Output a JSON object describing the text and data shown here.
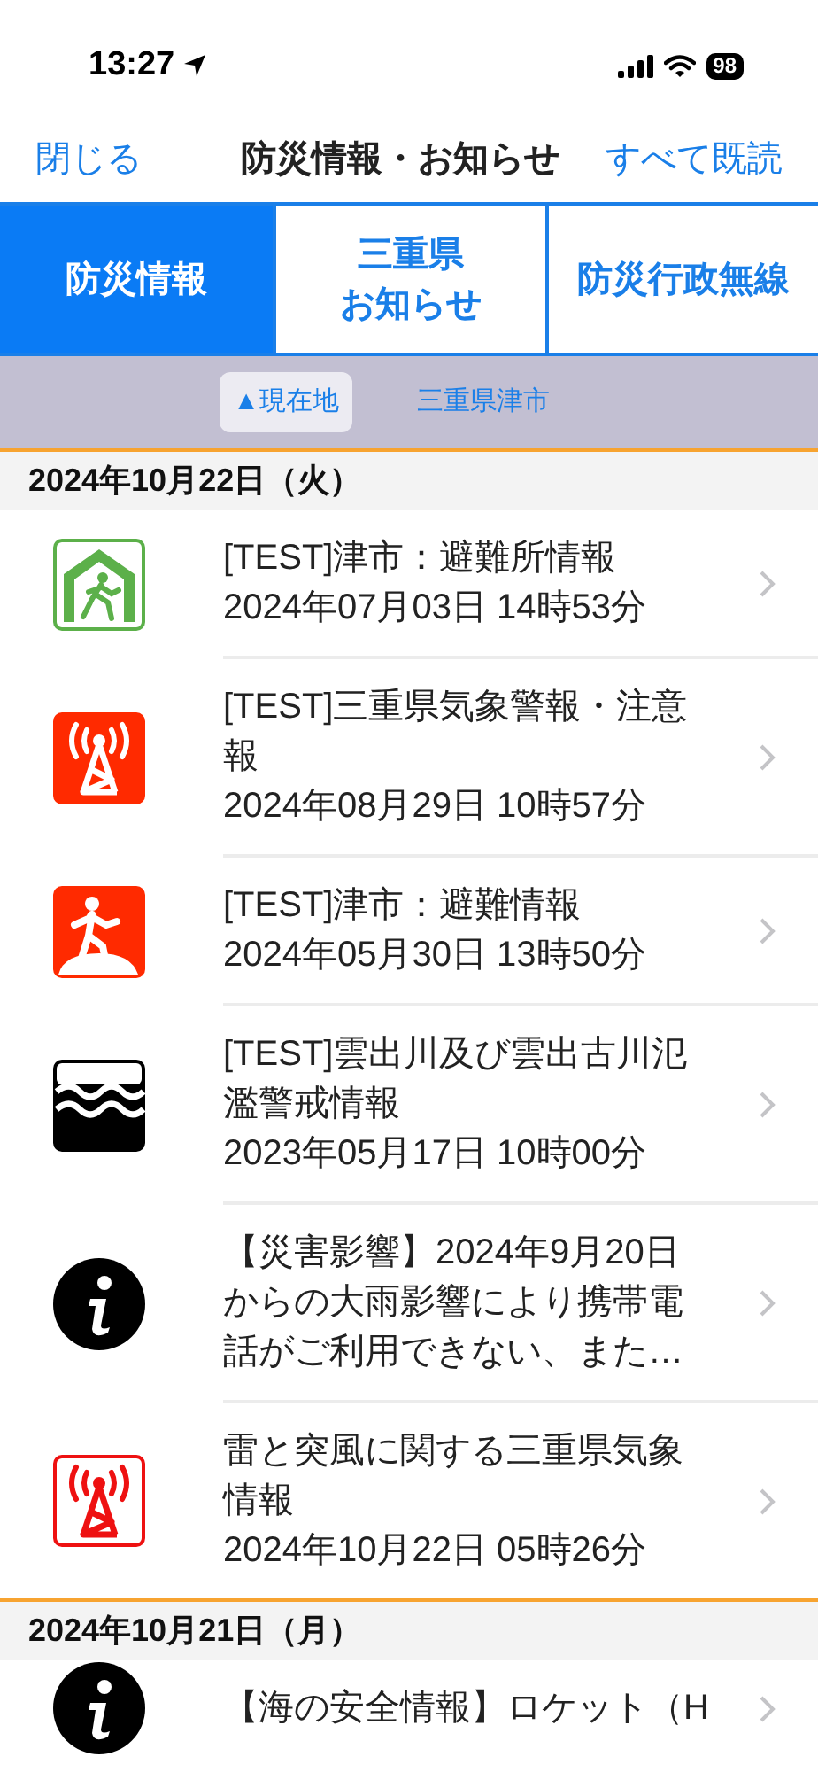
{
  "status_bar": {
    "time": "13:27",
    "battery": "98"
  },
  "nav": {
    "close": "閉じる",
    "title": "防災情報・お知らせ",
    "mark_all_read": "すべて既読"
  },
  "tabs": [
    {
      "lines": [
        "防災情報"
      ],
      "selected": true
    },
    {
      "lines": [
        "三重県",
        "お知らせ"
      ],
      "selected": false
    },
    {
      "lines": [
        "防災行政無線"
      ],
      "selected": false
    }
  ],
  "locations": [
    {
      "label": "▲現在地",
      "selected": true
    },
    {
      "label": "三重県津市",
      "selected": false
    }
  ],
  "sections": [
    {
      "date": "2024年10月22日（火）",
      "items": [
        {
          "kind": "shelter",
          "title": [
            "[TEST]津市：避難所情報"
          ],
          "time": "2024年07月03日 14時53分"
        },
        {
          "kind": "tower",
          "title": [
            "[TEST]三重県気象警報・注意",
            "報"
          ],
          "time": "2024年08月29日 10時57分"
        },
        {
          "kind": "evacuate",
          "title": [
            "[TEST]津市：避難情報"
          ],
          "time": "2024年05月30日 13時50分"
        },
        {
          "kind": "flood",
          "title": [
            "[TEST]雲出川及び雲出古川氾",
            "濫警戒情報"
          ],
          "time": "2023年05月17日 10時00分"
        },
        {
          "kind": "info",
          "title": [
            "【災害影響】2024年9月20日",
            "からの大雨影響により携帯電",
            "話がご利用できない、また…"
          ]
        },
        {
          "kind": "tower-outline",
          "title": [
            "雷と突風に関する三重県気象",
            "情報"
          ],
          "time": "2024年10月22日 05時26分"
        }
      ]
    },
    {
      "date": "2024年10月21日（月）",
      "items": [
        {
          "kind": "info",
          "title": [
            "【海の安全情報】ロケット（H"
          ]
        }
      ]
    }
  ]
}
